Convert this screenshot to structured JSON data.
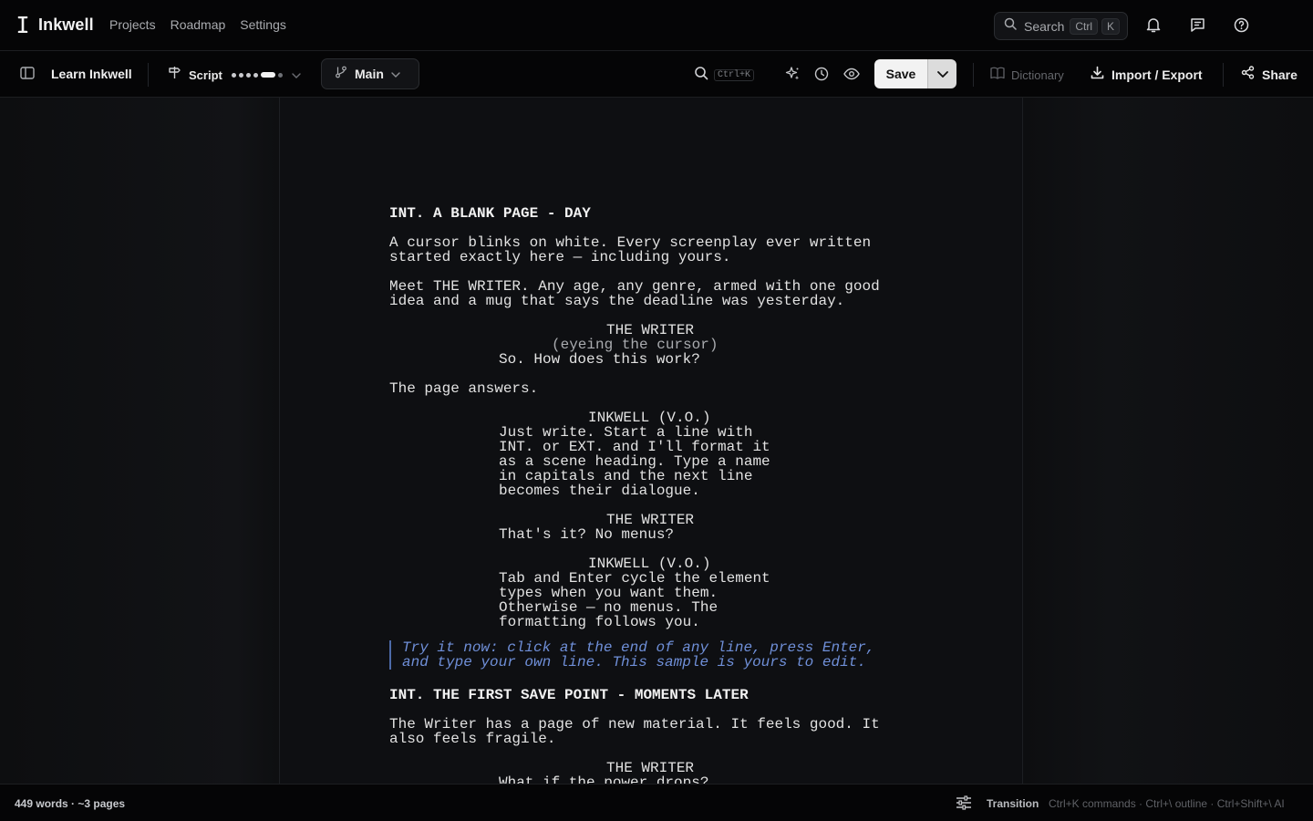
{
  "app": {
    "brand": "Inkwell",
    "nav": [
      "Projects",
      "Roadmap",
      "Settings"
    ],
    "search": {
      "label": "Search",
      "kbd_mod": "Ctrl",
      "kbd_key": "K"
    }
  },
  "toolbar": {
    "doc_title": "Learn Inkwell",
    "mode_label": "Script",
    "branch_label": "Main",
    "find_kbd": "Ctrl+K",
    "save_label": "Save",
    "dictionary_label": "Dictionary",
    "import_export_label": "Import / Export",
    "share_label": "Share"
  },
  "script_lines": {
    "l1": "INT. A BLANK PAGE - DAY",
    "l2": "A cursor blinks on white. Every screenplay ever written",
    "l3": "started exactly here — including yours.",
    "l4": "Meet THE WRITER. Any age, any genre, armed with one good",
    "l5": "idea and a mug that says the deadline was yesterday.",
    "l6": "THE WRITER",
    "l7": "(eyeing the cursor)",
    "l8": "So. How does this work?",
    "l9": "The page answers.",
    "l10": "INKWELL (V.O.)",
    "l11": "Just write. Start a line with",
    "l12": "INT. or EXT. and I'll format it",
    "l13": "as a scene heading. Type a name",
    "l14": "in capitals and the next line",
    "l15": "becomes their dialogue.",
    "l16": "THE WRITER",
    "l17": "That's it? No menus?",
    "l18": "INKWELL (V.O.)",
    "l19": "Tab and Enter cycle the element",
    "l20": "types when you want them.",
    "l21": "Otherwise — no menus. The",
    "l22": "formatting follows you.",
    "hint1": "Try it now: click at the end of any line, press Enter,",
    "hint2": "and type your own line. This sample is yours to edit.",
    "l23": "INT. THE FIRST SAVE POINT - MOMENTS LATER",
    "l24": "The Writer has a page of new material. It feels good. It",
    "l25": "also feels fragile.",
    "l26": "THE WRITER",
    "l27": "What if the power drops?"
  },
  "status": {
    "word_count": "449 words · ~3 pages",
    "element_type": "Transition",
    "shortcuts": "Ctrl+K commands · Ctrl+\\ outline · Ctrl+Shift+\\ AI"
  },
  "icons": [
    "text-cursor-icon",
    "search-icon",
    "bell-icon",
    "message-icon",
    "help-icon",
    "sidebar-icon",
    "signpost-icon",
    "branch-icon",
    "chevron-down-icon",
    "sparkles-icon",
    "clock-icon",
    "eye-icon",
    "book-icon",
    "download-icon",
    "share-icon",
    "sliders-icon"
  ]
}
